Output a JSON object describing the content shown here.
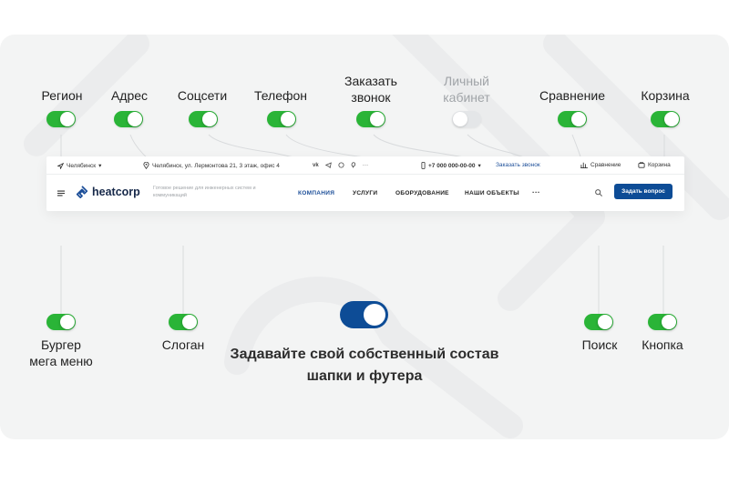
{
  "toggles_top": [
    {
      "id": "region",
      "label": "Регион",
      "on": true
    },
    {
      "id": "address",
      "label": "Адрес",
      "on": true
    },
    {
      "id": "social",
      "label": "Соцсети",
      "on": true
    },
    {
      "id": "phone",
      "label": "Телефон",
      "on": true
    },
    {
      "id": "callback",
      "label": "Заказать\nзвонок",
      "on": true
    },
    {
      "id": "account",
      "label": "Личный\nкабинет",
      "on": false
    },
    {
      "id": "compare",
      "label": "Сравнение",
      "on": true
    },
    {
      "id": "cart",
      "label": "Корзина",
      "on": true
    }
  ],
  "toggles_bottom": [
    {
      "id": "burger",
      "label": "Бургер\nмега меню",
      "on": true
    },
    {
      "id": "slogan",
      "label": "Слоган",
      "on": true
    },
    {
      "id": "search",
      "label": "Поиск",
      "on": true
    },
    {
      "id": "button",
      "label": "Кнопка",
      "on": true
    }
  ],
  "header": {
    "topbar": {
      "city": "Челябинск",
      "address": "Челябинск, ул. Лермонтова 21, 3 этаж, офис 4",
      "more": "···",
      "phone": "+7 000 000-00-00",
      "callback": "Заказать звонок",
      "compare": "Сравнение",
      "cart": "Корзина"
    },
    "logo": "heatcorp",
    "slogan": "Готовое решение для инженерных систем и коммуникаций",
    "nav": [
      "КОМПАНИЯ",
      "УСЛУГИ",
      "ОБОРУДОВАНИЕ",
      "НАШИ ОБЪЕКТЫ"
    ],
    "nav_more": "···",
    "cta": "Задать вопрос"
  },
  "headline": "Задавайте свой собственный состав шапки и футера",
  "colors": {
    "toggle_on": "#2ab437",
    "toggle_off": "#e4e6e8",
    "accent": "#0d4c96",
    "link": "#1d4f99"
  },
  "icons": [
    "location-icon",
    "map-pin-icon",
    "vk-icon",
    "telegram-icon",
    "whatsapp-icon",
    "viber-icon",
    "phone-icon",
    "compare-icon",
    "cart-icon",
    "burger-icon",
    "logo-icon",
    "search-icon"
  ]
}
